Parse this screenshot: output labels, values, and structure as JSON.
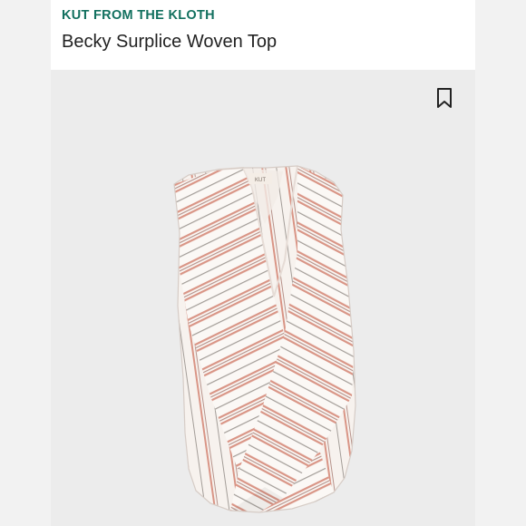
{
  "product": {
    "brand": "KUT FROM THE KLOTH",
    "name": "Becky Surplice Woven Top",
    "image": {
      "subject": "sleeveless surplice wrap top, white with pink and grey vertical stripes",
      "tag_text": "KUT"
    }
  },
  "actions": {
    "bookmark_icon": "bookmark-outline"
  },
  "colors": {
    "brand_text": "#12705f",
    "title_text": "#222222",
    "image_background": "#ececec",
    "header_background": "#ffffff",
    "stripe_pink": "#d99586",
    "stripe_grey": "#a39d98",
    "fabric": "#fbf8f5"
  }
}
